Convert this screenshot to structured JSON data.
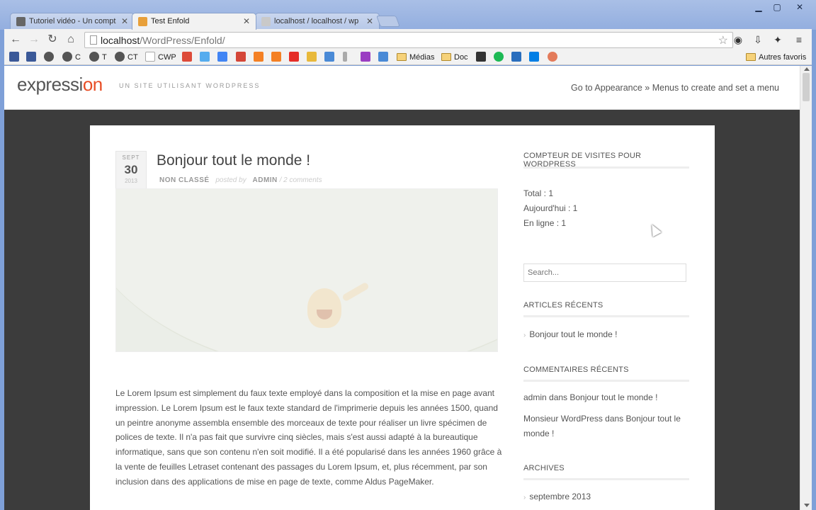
{
  "browser": {
    "tabs": [
      {
        "label": "Tutoriel vidéo - Un compt",
        "icon": "wordpress-icon"
      },
      {
        "label": "Test Enfold",
        "icon": "enfold-icon"
      },
      {
        "label": "localhost / localhost / wp",
        "icon": "phpmyadmin-icon"
      }
    ],
    "url_host": "localhost",
    "url_path": "/WordPress/Enfold/",
    "bookmarks": [
      {
        "label": "",
        "icon": "facebook-icon",
        "color": "#3b5998"
      },
      {
        "label": "",
        "icon": "facebook-icon",
        "color": "#3b5998"
      },
      {
        "label": "",
        "icon": "wordpress-icon",
        "color": "#555"
      },
      {
        "label": "C",
        "icon": "wordpress-icon",
        "color": "#555"
      },
      {
        "label": "T",
        "icon": "wordpress-icon",
        "color": "#555"
      },
      {
        "label": "CT",
        "icon": "wordpress-icon",
        "color": "#555"
      },
      {
        "label": "CWP",
        "icon": "page-icon",
        "color": "#fff"
      },
      {
        "label": "",
        "icon": "google-plus-icon",
        "color": "#dd4b39"
      },
      {
        "label": "",
        "icon": "twitter-icon",
        "color": "#55acee"
      },
      {
        "label": "",
        "icon": "google-icon",
        "color": "#4285f4"
      },
      {
        "label": "",
        "icon": "gmail-icon",
        "color": "#d44638"
      },
      {
        "label": "",
        "icon": "orange-icon",
        "color": "#f48024"
      },
      {
        "label": "",
        "icon": "orange-icon",
        "color": "#f48024"
      },
      {
        "label": "",
        "icon": "youtube-icon",
        "color": "#e52d27"
      },
      {
        "label": "",
        "icon": "pin-icon",
        "color": "#e8b93b"
      },
      {
        "label": "",
        "icon": "tool-icon",
        "color": "#4a8ad6"
      },
      {
        "label": "",
        "icon": "bar-icon",
        "color": "#aaa"
      },
      {
        "label": "",
        "icon": "grid-icon",
        "color": "#9a3ec2"
      },
      {
        "label": "",
        "icon": "translate-icon",
        "color": "#4a8ad6"
      },
      {
        "label": "Médias",
        "icon": "folder-icon",
        "color": "#f6d27a"
      },
      {
        "label": "Doc",
        "icon": "folder-icon",
        "color": "#f6d27a"
      },
      {
        "label": "",
        "icon": "p-icon",
        "color": "#333"
      },
      {
        "label": "",
        "icon": "spotify-icon",
        "color": "#1db954"
      },
      {
        "label": "",
        "icon": "h-icon",
        "color": "#2a6ebd"
      },
      {
        "label": "",
        "icon": "dropbox-icon",
        "color": "#007ee5"
      },
      {
        "label": "",
        "icon": "gear-icon",
        "color": "#e37b5b"
      }
    ],
    "other_bookmarks": "Autres favoris"
  },
  "site": {
    "logo_prefix": "expressi",
    "logo_accent": "on",
    "tagline": "UN SITE UTILISANT WORDPRESS",
    "menu_hint": "Go to Appearance » Menus to create and set a menu"
  },
  "post": {
    "date_month": "SEPT",
    "date_day": "30",
    "date_year": "2013",
    "title": "Bonjour tout le monde !",
    "category": "NON CLASSÉ",
    "posted_by": "posted by",
    "author": "ADMIN",
    "comments": "/ 2 comments",
    "body": "Le Lorem Ipsum est simplement du faux texte employé dans la composition et la mise en page avant impression. Le Lorem Ipsum est le faux texte standard de l'imprimerie depuis les années 1500, quand un peintre anonyme assembla ensemble des morceaux de texte pour réaliser un livre spécimen de polices de texte. Il n'a pas fait que survivre cinq siècles, mais s'est aussi adapté à la bureautique informatique, sans que son contenu n'en soit modifié. Il a été popularisé dans les années 1960 grâce à la vente de feuilles Letraset contenant des passages du Lorem Ipsum, et, plus récemment, par son inclusion dans des applications de mise en page de texte, comme Aldus PageMaker."
  },
  "sidebar": {
    "counter_title": "COMPTEUR DE VISITES POUR WORDPRESS",
    "total": "Total : 1",
    "today": "Aujourd'hui : 1",
    "online": "En ligne : 1",
    "search_placeholder": "Search...",
    "recent_title": "ARTICLES RÉCENTS",
    "recent_item": "Bonjour tout le monde !",
    "comments_title": "COMMENTAIRES RÉCENTS",
    "comment1": "admin dans Bonjour tout le monde !",
    "comment2": "Monsieur WordPress dans Bonjour tout le monde !",
    "archives_title": "ARCHIVES",
    "archive_item": "septembre 2013"
  },
  "colors": {
    "accent": "#e84e26",
    "page_bg": "#3c3c3c",
    "chrome_frame": "#93aedf"
  }
}
